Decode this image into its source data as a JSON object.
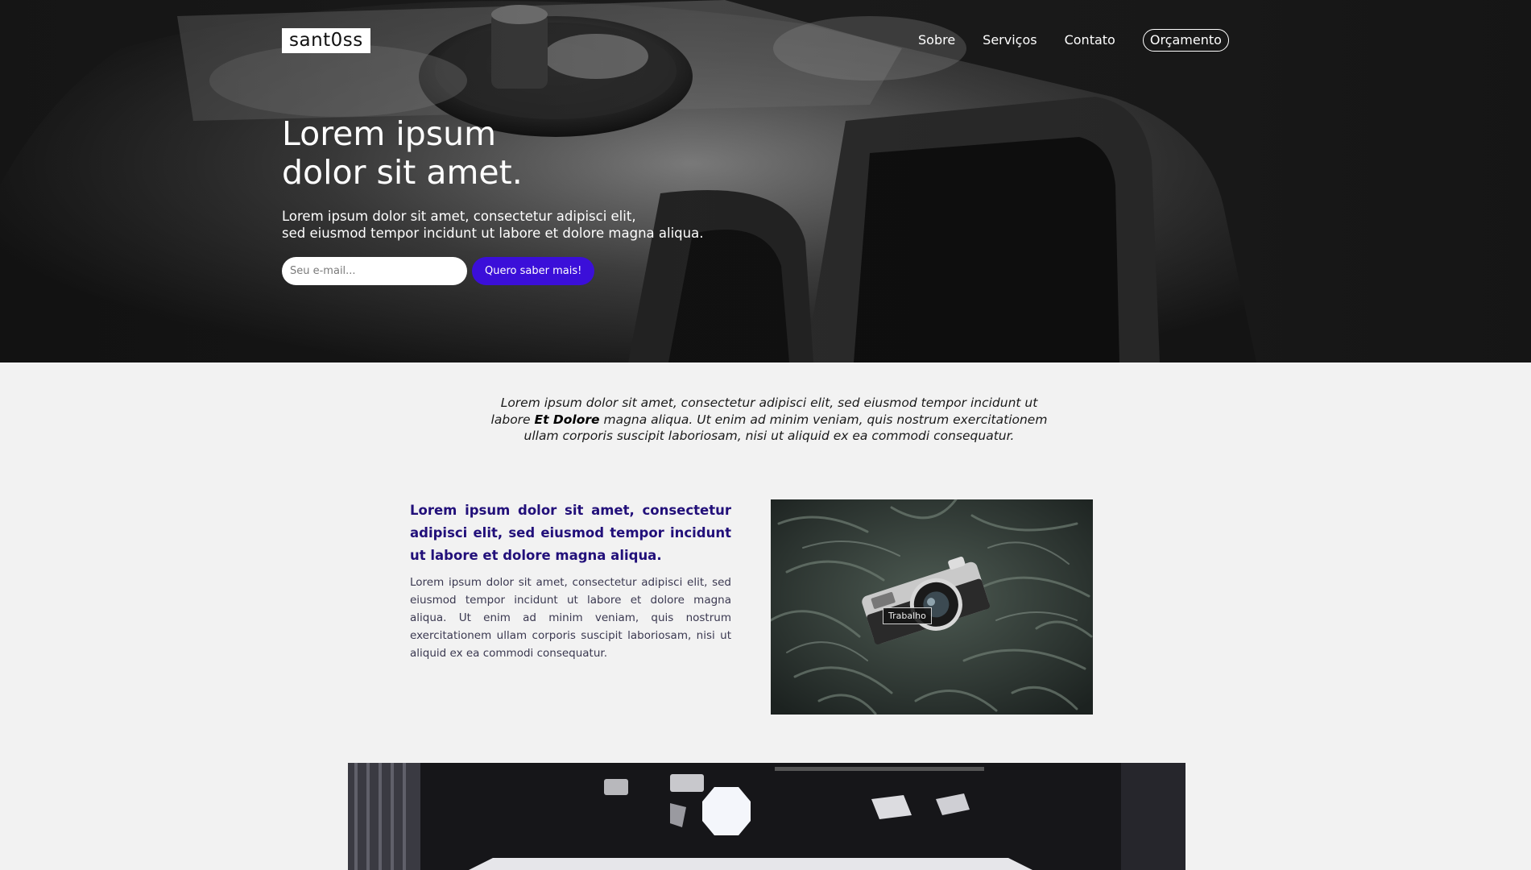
{
  "brand": {
    "logo_text": "sant0ss"
  },
  "nav": {
    "items": [
      "Sobre",
      "Serviços",
      "Contato"
    ],
    "cta_label": "Orçamento"
  },
  "hero": {
    "title_lines": [
      "Lorem ipsum",
      "dolor sit amet."
    ],
    "subtitle_lines": [
      "Lorem ipsum dolor sit amet, consectetur adipisci elit,",
      "sed eiusmod tempor incidunt ut labore et dolore magna aliqua."
    ],
    "email_placeholder": "Seu e-mail...",
    "button_label": "Quero saber mais!"
  },
  "intro": {
    "before": "Lorem ipsum dolor sit amet, consectetur adipisci elit, sed eiusmod tempor incidunt ut labore ",
    "emphasis": "Et Dolore",
    "after": " magna aliqua. Ut enim ad minim veniam, quis nostrum exercitationem ullam corporis suscipit laboriosam, nisi ut aliquid ex ea commodi consequatur."
  },
  "feature": {
    "heading": "Lorem ipsum dolor sit amet, consectetur adipisci elit, sed eiusmod tempor incidunt ut labore et dolore magna aliqua.",
    "body": "Lorem ipsum dolor sit amet, consectetur adipisci elit, sed eiusmod tempor incidunt ut labore et dolore magna aliqua. Ut enim ad minim veniam, quis nostrum exercitationem ullam corporis suscipit laboriosam, nisi ut aliquid ex ea commodi consequatur.",
    "image_caption": "Trabalho"
  },
  "colors": {
    "accent": "#3b0fd9",
    "heading_purple": "#22107a",
    "background": "#f2f2f2"
  }
}
